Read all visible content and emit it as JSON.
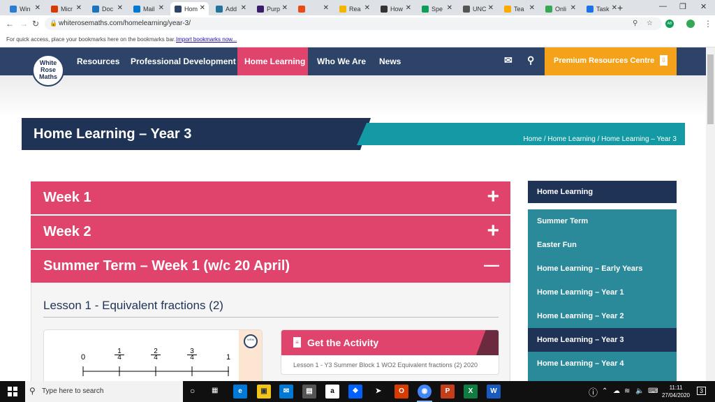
{
  "browser": {
    "tabs": [
      {
        "label": "Win",
        "color": "#2b7cd3"
      },
      {
        "label": "Micr",
        "color": "#d83b01"
      },
      {
        "label": "Doc",
        "color": "#1e73be"
      },
      {
        "label": "Mail",
        "color": "#0078d4"
      },
      {
        "label": "Hom",
        "color": "#2d4468"
      },
      {
        "label": "Add",
        "color": "#21759b"
      },
      {
        "label": "Purp",
        "color": "#3b1c6b"
      },
      {
        "label": "",
        "color": "#e64a19"
      },
      {
        "label": "Rea",
        "color": "#f2b600"
      },
      {
        "label": "How",
        "color": "#333333"
      },
      {
        "label": "Spe",
        "color": "#0f9d58"
      },
      {
        "label": "UNC",
        "color": "#555555"
      },
      {
        "label": "Tea",
        "color": "#f9ab00"
      },
      {
        "label": "Onli",
        "color": "#34a853"
      },
      {
        "label": "Task",
        "color": "#1a73e8"
      }
    ],
    "url": "whiterosemaths.com/homelearning/year-3/",
    "bookmark_hint": "For quick access, place your bookmarks here on the bookmarks bar.",
    "import_link": "Import bookmarks now...",
    "profile_initials": "AB"
  },
  "site": {
    "logo": [
      "White",
      "Rose",
      "Maths"
    ],
    "nav": [
      "Resources",
      "Professional Development",
      "Home Learning",
      "Who We Are",
      "News"
    ],
    "premium_label": "Premium Resources Centre",
    "accent_pink": "#e0446c",
    "navy": "#1e3355",
    "teal": "#149aa4",
    "orange": "#f4a21a"
  },
  "page": {
    "title": "Home Learning – Year 3",
    "breadcrumb": "Home / Home Learning / Home Learning – Year 3"
  },
  "accordion": [
    {
      "title": "Week 1",
      "toggle": "+"
    },
    {
      "title": "Week 2",
      "toggle": "+"
    },
    {
      "title": "Summer Term – Week 1 (w/c 20 April)",
      "toggle": "—"
    }
  ],
  "lesson": {
    "title": "Lesson 1 - Equivalent fractions (2)",
    "number_line": {
      "start": "0",
      "fractions": [
        [
          "1",
          "4"
        ],
        [
          "2",
          "4"
        ],
        [
          "3",
          "4"
        ]
      ],
      "end": "1"
    },
    "activity_label": "Get the Activity",
    "activity_desc": "Lesson 1 - Y3 Summer Block 1 WO2 Equivalent fractions (2) 2020"
  },
  "sidebar": {
    "heading": "Home Learning",
    "items": [
      {
        "label": "Summer Term",
        "active": false
      },
      {
        "label": "Easter Fun",
        "active": false
      },
      {
        "label": "Home Learning – Early Years",
        "active": false
      },
      {
        "label": "Home Learning – Year 1",
        "active": false
      },
      {
        "label": "Home Learning – Year 2",
        "active": false
      },
      {
        "label": "Home Learning – Year 3",
        "active": true
      },
      {
        "label": "Home Learning – Year 4",
        "active": false
      }
    ]
  },
  "taskbar": {
    "search_placeholder": "Type here to search",
    "time": "11:11",
    "date": "27/04/2020",
    "notifications": "3"
  }
}
